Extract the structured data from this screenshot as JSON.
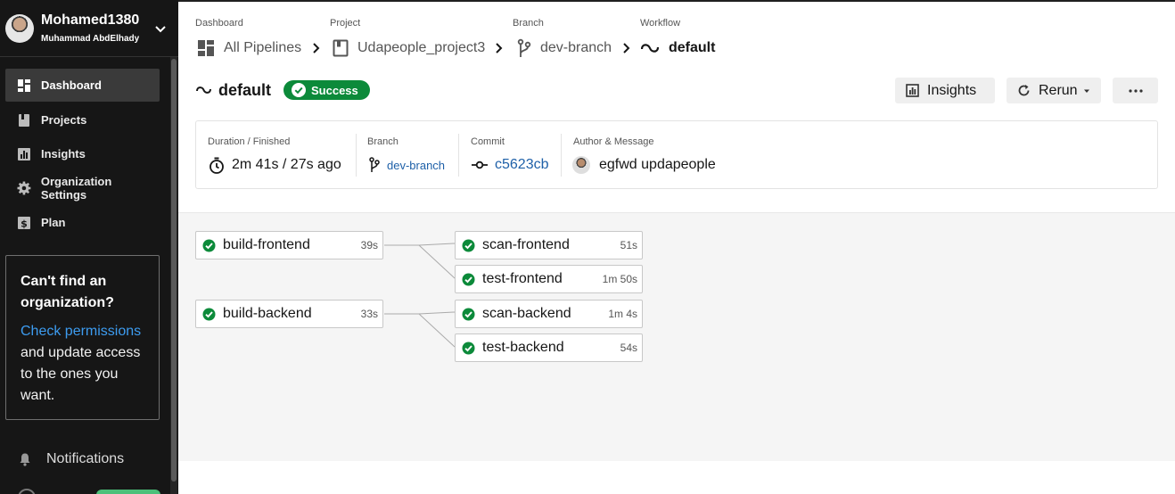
{
  "user": {
    "username": "Mohamed1380",
    "full_name": "Muhammad AbdElhady"
  },
  "sidebar": {
    "items": [
      {
        "label": "Dashboard",
        "icon": "dashboard-icon",
        "active": true
      },
      {
        "label": "Projects",
        "icon": "projects-icon",
        "active": false
      },
      {
        "label": "Insights",
        "icon": "insights-icon",
        "active": false
      },
      {
        "label": "Organization Settings",
        "icon": "gear-icon",
        "active": false
      },
      {
        "label": "Plan",
        "icon": "dollar-icon",
        "active": false
      }
    ],
    "promo": {
      "title": "Can't find an organization?",
      "link": "Check permissions",
      "text": "and update access to the ones you want."
    },
    "notifications_label": "Notifications"
  },
  "breadcrumbs": [
    {
      "label": "Dashboard",
      "value": "All Pipelines",
      "icon": "pipelines-icon"
    },
    {
      "label": "Project",
      "value": "Udapeople_project3",
      "icon": "project-icon"
    },
    {
      "label": "Branch",
      "value": "dev-branch",
      "icon": "branch-icon"
    },
    {
      "label": "Workflow",
      "value": "default",
      "icon": "workflow-icon"
    }
  ],
  "workflow": {
    "name": "default",
    "status": "Success",
    "actions": {
      "insights": "Insights",
      "rerun": "Rerun",
      "more": "more-options-icon"
    }
  },
  "summary": {
    "duration_label": "Duration / Finished",
    "duration_value": "2m 41s / 27s ago",
    "branch_label": "Branch",
    "branch_value": "dev-branch",
    "commit_label": "Commit",
    "commit_value": "c5623cb",
    "author_label": "Author & Message",
    "author_value": "egfwd updapeople"
  },
  "jobs": [
    {
      "name": "build-frontend",
      "duration": "39s",
      "status": "success"
    },
    {
      "name": "scan-frontend",
      "duration": "51s",
      "status": "success"
    },
    {
      "name": "test-frontend",
      "duration": "1m 50s",
      "status": "success"
    },
    {
      "name": "build-backend",
      "duration": "33s",
      "status": "success"
    },
    {
      "name": "scan-backend",
      "duration": "1m 4s",
      "status": "success"
    },
    {
      "name": "test-backend",
      "duration": "54s",
      "status": "success"
    }
  ],
  "colors": {
    "success": "#0c8a3a",
    "sidebar_bg": "#161616",
    "link": "#1e60a8"
  }
}
